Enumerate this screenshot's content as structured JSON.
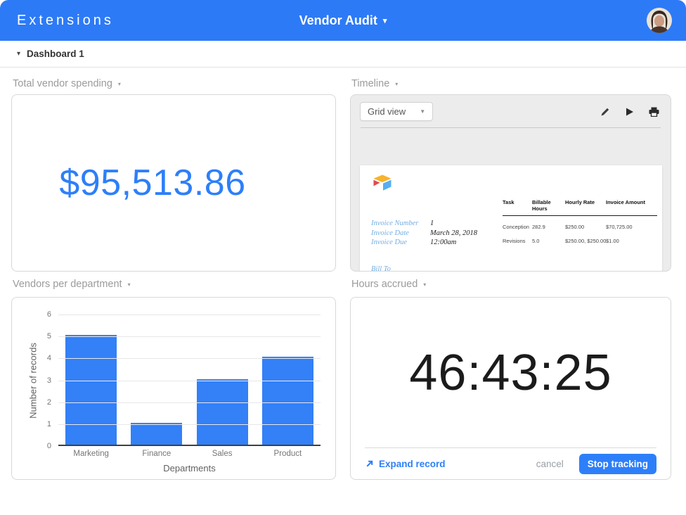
{
  "colors": {
    "accent": "#2d7ff9",
    "header_bg": "#2d7af7",
    "bar_fill": "#3380f7"
  },
  "header": {
    "app_title": "Extensions",
    "doc_title": "Vendor Audit",
    "caret": "▾"
  },
  "dashboard_bar": {
    "caret": "▾",
    "label": "Dashboard 1"
  },
  "panels": {
    "spending": {
      "title": "Total vendor spending",
      "caret": "▾",
      "value": "$95,513.86"
    },
    "timeline": {
      "title": "Timeline",
      "caret": "▾",
      "toolbar": {
        "view_label": "Grid view",
        "caret": "▼"
      },
      "invoice": {
        "fields": [
          {
            "label": "Invoice Number",
            "value": "1"
          },
          {
            "label": "Invoice Date",
            "value": "March 28, 2018"
          },
          {
            "label": "Invoice Due",
            "value": "12:00am"
          }
        ],
        "bill_to": "Bill To",
        "table": {
          "headers": [
            "Task",
            "Billable Hours",
            "Hourly Rate",
            "Invoice Amount"
          ],
          "rows": [
            [
              "Conception",
              "282.9",
              "$250.00",
              "$70,725.00"
            ],
            [
              "Revisions",
              "5.0",
              "$250.00, $250.00",
              "$1.00"
            ]
          ]
        }
      }
    },
    "vendors_chart": {
      "title": "Vendors per department",
      "caret": "▾"
    },
    "hours": {
      "title": "Hours accrued",
      "caret": "▾",
      "timer": "46:43:25",
      "expand_label": "Expand record",
      "cancel_label": "cancel",
      "stop_label": "Stop tracking"
    }
  },
  "chart_data": {
    "type": "bar",
    "categories": [
      "Marketing",
      "Finance",
      "Sales",
      "Product"
    ],
    "values": [
      5,
      1,
      3,
      4
    ],
    "title": "Vendors per department",
    "xlabel": "Departments",
    "ylabel": "Number of records",
    "ylim": [
      0,
      6
    ],
    "yticks": [
      0,
      1,
      2,
      3,
      4,
      5,
      6
    ],
    "grid": true,
    "legend": "none",
    "bar_color": "#3380f7"
  }
}
